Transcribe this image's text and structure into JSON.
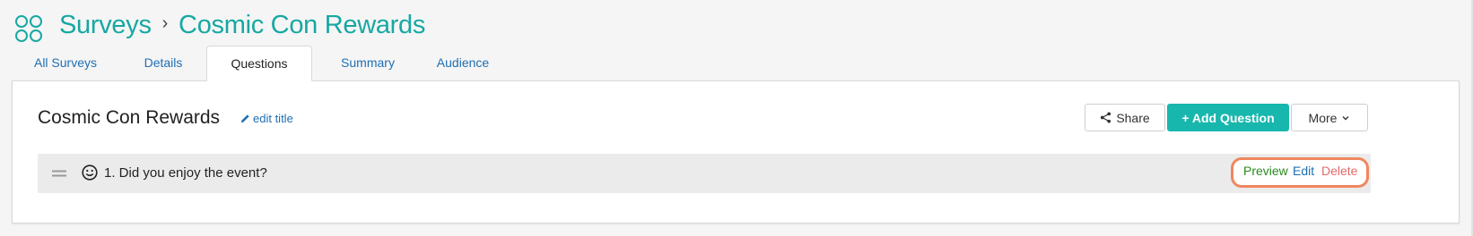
{
  "header": {
    "breadcrumb_root": "Surveys",
    "breadcrumb_separator": "›",
    "breadcrumb_current": "Cosmic Con Rewards",
    "app_icon": "apps-grid-icon"
  },
  "tabs": [
    {
      "label": "All Surveys",
      "active": false
    },
    {
      "label": "Details",
      "active": false
    },
    {
      "label": "Questions",
      "active": true
    },
    {
      "label": "Summary",
      "active": false
    },
    {
      "label": "Audience",
      "active": false
    }
  ],
  "survey": {
    "title": "Cosmic Con Rewards",
    "edit_title_label": "edit title"
  },
  "toolbar": {
    "share_label": "Share",
    "add_question_label": "+ Add Question",
    "more_label": "More"
  },
  "questions": [
    {
      "icon": "smiley-icon",
      "text": "1. Did you enjoy the event?",
      "actions": {
        "preview": "Preview",
        "edit": "Edit",
        "delete": "Delete"
      }
    }
  ],
  "colors": {
    "brand_teal": "#17a8a3",
    "add_button": "#17b7ad",
    "link_blue": "#1f6fb3",
    "preview_green": "#2a8a1f",
    "delete_red": "#e06a6a",
    "highlight_orange": "#f0875e"
  }
}
